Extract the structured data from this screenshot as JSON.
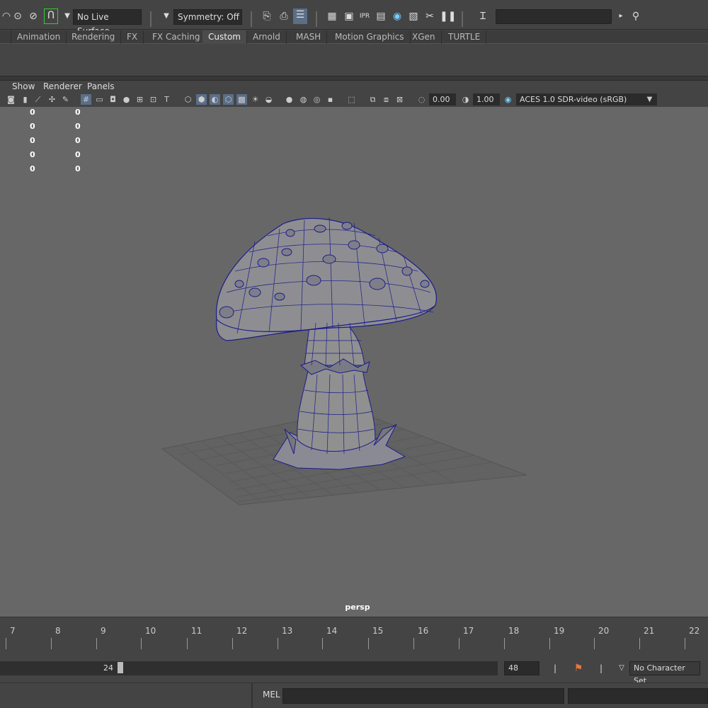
{
  "status_line": {
    "live_surface": "No Live Surface",
    "symmetry": "Symmetry: Off",
    "search_value": ""
  },
  "shelf_tabs": [
    "Animation",
    "Rendering",
    "FX",
    "FX Caching",
    "Custom",
    "Arnold",
    "MASH",
    "Motion Graphics",
    "XGen",
    "TURTLE"
  ],
  "active_shelf_tab": "Custom",
  "panel_menu": {
    "show": "Show",
    "renderer": "Renderer",
    "panels": "Panels"
  },
  "panel_toolbar": {
    "exposure": "0.00",
    "gamma": "1.00",
    "color_space": "ACES 1.0 SDR-video (sRGB)"
  },
  "hud": {
    "rows": [
      [
        "0",
        "0"
      ],
      [
        "0",
        "0"
      ],
      [
        "0",
        "0"
      ],
      [
        "0",
        "0"
      ],
      [
        "0",
        "0"
      ]
    ]
  },
  "viewport": {
    "camera": "persp",
    "background_color": "#676767",
    "wireframe_color": "#1c1c8c"
  },
  "timeline": {
    "ticks": [
      "7",
      "8",
      "9",
      "10",
      "11",
      "12",
      "13",
      "14",
      "15",
      "16",
      "17",
      "18",
      "19",
      "20",
      "21",
      "22"
    ]
  },
  "range": {
    "end_current": "24",
    "end_total": "48",
    "character_set": "No Character Set"
  },
  "command_line": {
    "mode": "MEL",
    "input_value": "",
    "result_value": ""
  }
}
